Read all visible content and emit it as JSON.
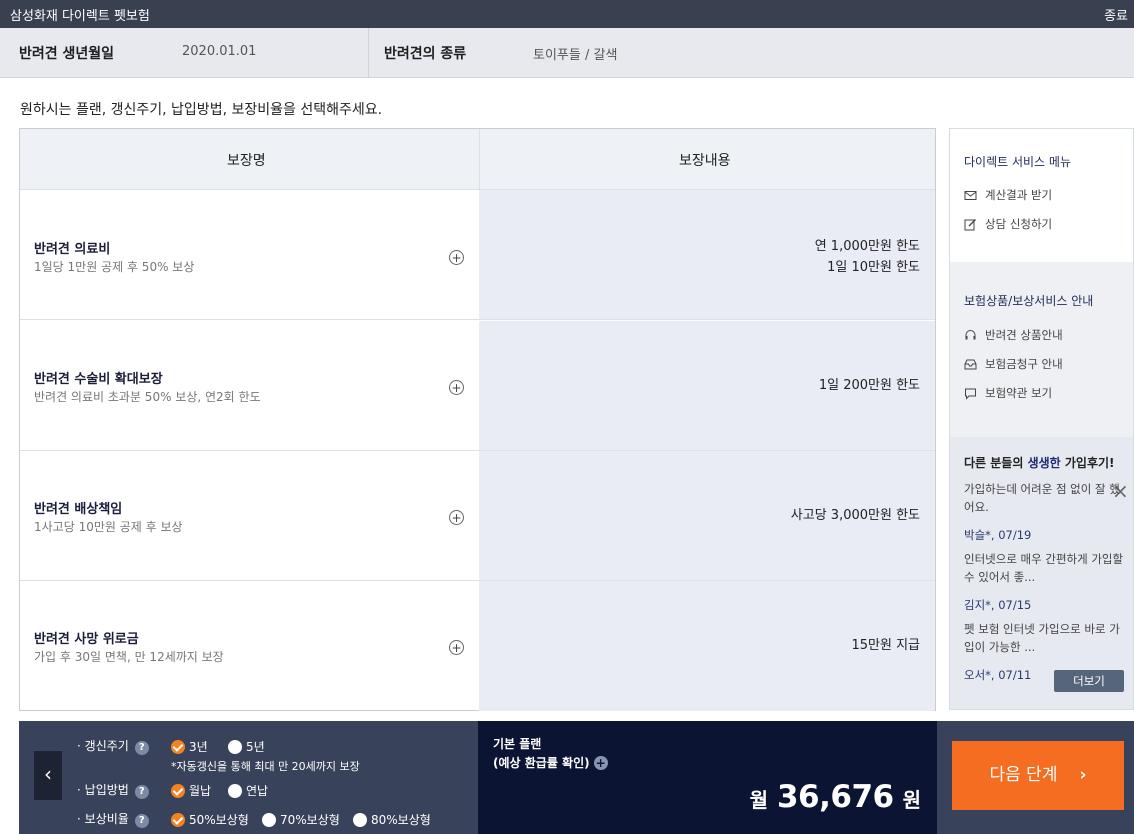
{
  "window": {
    "title": "삼성화재 다이렉트 펫보험",
    "close_label": "종료"
  },
  "info": {
    "birth_label": "반려견 생년월일",
    "birth_value": "2020.01.01",
    "breed_label": "반려견의 종류",
    "breed_value": "토이푸들 / 갈색"
  },
  "instruction": "원하시는 플랜, 갱신주기, 납입방법, 보장비율을 선택해주세요.",
  "table": {
    "col_name": "보장명",
    "col_content": "보장내용",
    "rows": [
      {
        "name": "반려견 의료비",
        "desc": "1일당 1만원 공제 후 50% 보상",
        "amount_1": "연 1,000만원 한도",
        "amount_2": "1일 10만원 한도"
      },
      {
        "name": "반려견 수술비 확대보장",
        "desc": "반려견 의료비 초과분 50% 보상, 연2회 한도",
        "amount_1": "1일 200만원 한도"
      },
      {
        "name": "반려견 배상책임",
        "desc": "1사고당 10만원 공제 후 보상",
        "amount_1": "사고당 3,000만원 한도"
      },
      {
        "name": "반려견 사망 위로금",
        "desc": "가입 후 30일 면책, 만 12세까지 보장",
        "amount_1": "15만원 지급"
      }
    ]
  },
  "sidebar": {
    "service_menu_title": "다이렉트 서비스 메뉴",
    "service_items": [
      "계산결과 받기",
      "상담 신청하기"
    ],
    "guide_title": "보험상품/보상서비스 안내",
    "guide_items": [
      "반려견 상품안내",
      "보험금청구 안내",
      "보험약관 보기"
    ],
    "reviews": {
      "title_prefix": "다른 분들의 ",
      "title_highlight": "생생한",
      "title_suffix": " 가입후기!",
      "items": [
        {
          "text": "가입하는데 어려운 점 없이 잘 했어요.",
          "author": "박슬*, 07/19"
        },
        {
          "text": "인터넷으로 매우 간편하게 가입할 수 있어서 좋...",
          "author": "김지*, 07/15"
        },
        {
          "text": "펫 보험 인터넷 가입으로 바로 가입이 가능한 ...",
          "author": "오서*, 07/11"
        }
      ],
      "more_label": "더보기"
    }
  },
  "options": {
    "renewal_label": "갱신주기",
    "renewal_options": [
      "3년",
      "5년"
    ],
    "renewal_selected": "3년",
    "renewal_note": "*자동갱신을 통해 최대 만 20세까지 보장",
    "payment_label": "납입방법",
    "payment_options": [
      "월납",
      "연납"
    ],
    "payment_selected": "월납",
    "ratio_label": "보상비율",
    "ratio_options": [
      "50%보상형",
      "70%보상형",
      "80%보상형"
    ],
    "ratio_selected": "50%보상형",
    "question_mark": "?",
    "bullet": "·"
  },
  "plan": {
    "line1": "기본 플랜",
    "line2": "(예상 환급률 확인)",
    "price_prefix": "월",
    "price_value": "36,676",
    "price_unit": "원"
  },
  "nav": {
    "prev_label": "‹",
    "next_label": "다음 단계",
    "next_arrow": "›"
  },
  "colors": {
    "accent": "#f46d20",
    "dark_navy": "#0b1433",
    "title_bar": "#394150",
    "check": "#f58220"
  }
}
